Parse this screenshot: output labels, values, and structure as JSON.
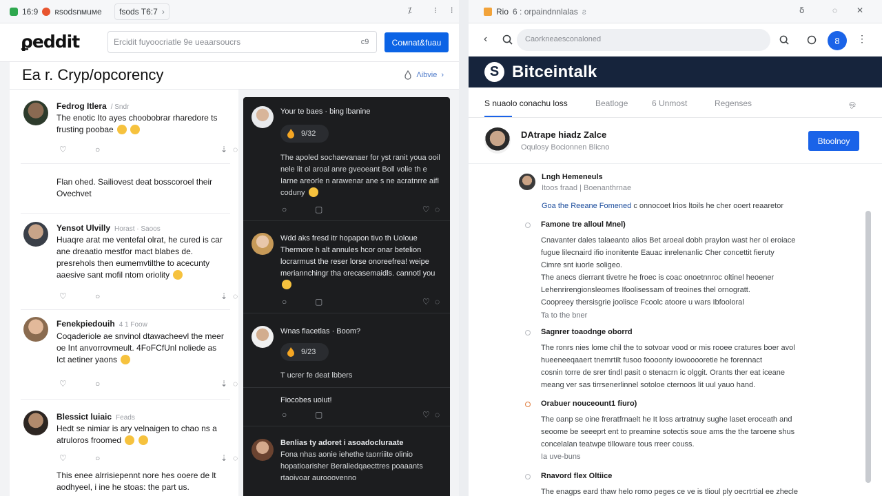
{
  "left_window": {
    "tab": {
      "favicon": "chat-icon",
      "time": "16:9",
      "label": "ʀsodsnᴍuᴍe",
      "second_tab": "fsods T6:7"
    },
    "header": {
      "logo": "ϼeddit",
      "search_placeholder": "Ercidit fuyoocriatle 9e ueaarsoucrs",
      "search_button": "c9",
      "cta": "Coᴍnat&fuau"
    },
    "subreddit": {
      "title": "Ea r. Cryp/opcorency",
      "sort": "Ʌibvie"
    },
    "posts": [
      {
        "author": "Fedrog Itlera",
        "meta": "/ Sndr",
        "body": "The enotic Ito ayes choobobrar rharedore ts frusting poobae"
      },
      {
        "author": "",
        "meta": "",
        "body": "Flan ohed. Sailiovest deat bosscoroel their Ovechvet"
      },
      {
        "author": "Yensot Ulvilly",
        "meta": "Horast · Saoos",
        "body": "Huaqre arat me ventefal olrat, he cured is car ane dreaatio mestfor mact blabes de. presrehols then eumemvtilthe to acecunty aaesive sant mofil ntom oriolity"
      },
      {
        "author": "Fenekpiedouih",
        "meta": "4 1 Foow",
        "body": "Coqaderiole ae snvinol dtawacheevl the meer oe Int anvorrovmeult. 4FoFCfUnl noliede as Ict aetiner yaons"
      },
      {
        "author": "Blessict luiaic",
        "meta": "Feads",
        "body": "Hedt se nimiar is ary velnaigen to chao ns a atruloros froomed"
      },
      {
        "author": "",
        "meta": "",
        "body": "This enee alrrisiepennt nore hes ooere de lt aodhyeel, i ine he stoas: the part us."
      }
    ],
    "dark_feed": [
      {
        "title": "Your te baes · bing lbanine",
        "score": "9/32",
        "body": "The apoled sochaevanaer for yst ranit youa ooil nele lit ol aroal anre gveoeant Boll volie th e Iarne areorle n arawenar ane s ne acratnrre aifl coduny"
      },
      {
        "title": "Wdd aks fresd itr hopapon tivo th Uoloue Thermore h alt annules hcor onar betelion locrarmust the reser lorse onoreefrea! weipe meriannchingr tha orecasemaidls. cannotl you"
      },
      {
        "title": "Wnas flacetlas · Boom?",
        "score": "9/23",
        "body": "T ucrer fe deat lbbers"
      },
      {
        "title": "Fiocobes uoiut!"
      },
      {
        "title": "Benlias ty adoret i asoadocluraate",
        "body": "Fona nhas aonie iehethe taorriiite olinio hopatioarisher Beraliedqaecttres poaaants rtaoivoar aurooovenno"
      }
    ]
  },
  "right_window": {
    "tab": {
      "favicon": "btc-icon",
      "label": "Rio",
      "second": "6 : orpaindnnlalas",
      "extra": "ƨ"
    },
    "url_placeholder": "Caorkneaesconaloned",
    "account_initial": "8",
    "brand": "Bitceintalk",
    "tabs": [
      "S nuaolo conachu loss",
      "Beatloge",
      "6 Unmost",
      "Regenses",
      "ஒ"
    ],
    "thread": {
      "title": "DAtrape hiadz Zalce",
      "sub": "Oqulosy   Bocionnen   Blicno",
      "follow": "Btoolnoy"
    },
    "reply": {
      "name": "Lngh Hemeneuls",
      "sub": "Itoos fraad | Boenanthrnae",
      "link": "Goa the Reeane Fomened",
      "link_rest": "c onnocoet lrios ltoils he cher ooert reaaretor"
    },
    "sections": [
      {
        "heading": "Famone tre alloul Mnel)",
        "lines": [
          "Cnavanter dales talaeanto alios Bet aroeal dobh praylon wast her ol eroiace",
          "fugue lilecnaird ifio inonitente Eauac inrelenanlic Cher concettit fieruty",
          "Cimre snt iuorle soligeo.",
          "The anecs dierrant tivetre he froec is coac onoetnnroc oltinel heoener",
          "Lehenrirengionsleomes Ifoolisessam of treoines thel ornogratt.",
          "Coopreey thersisgrie joolisce Fcoolc atoore u wars Ibfooloral"
        ],
        "tail": "Ta to the bner"
      },
      {
        "heading": "Sagnrer toaodnge oborrd",
        "lines": [
          "The ronrs nies lome chil the to sotvoar vood or mis rooee cratures boer avol",
          "hueeneeqaaert tnemrtilt fusoo foooonty iowooooretie he forennact",
          "cosnin torre de srer tindl pasit o stenacrn ic olggit. Orants ther eat iceane",
          "meang ver sas tirrsenerlinnel sotoloe cternoos lit uul yauo hand."
        ]
      },
      {
        "heading": "Orabuer nouceount1 fiuro)",
        "lines": [
          "The oanp se oine freratfrnaelt he It loss artratnuy sughe laset eroceath and",
          "seoome be seeeprt ent to preamine sotectis soue ams the the taroene shus",
          "concelalan teatwpe tilloware tous rreer couss."
        ],
        "tail": "Ia uve-buns"
      },
      {
        "heading": "Rnavord flex Oltiice",
        "lines": [
          "The enagps eard thaw helo romo peges ce ve is tlioul ply oecrtrtial ee zhecle"
        ]
      }
    ]
  },
  "colors": {
    "accent": "#0b63e5",
    "bitcointalk_banner": "#16243c",
    "dark_feed": "#1c1d1f"
  }
}
